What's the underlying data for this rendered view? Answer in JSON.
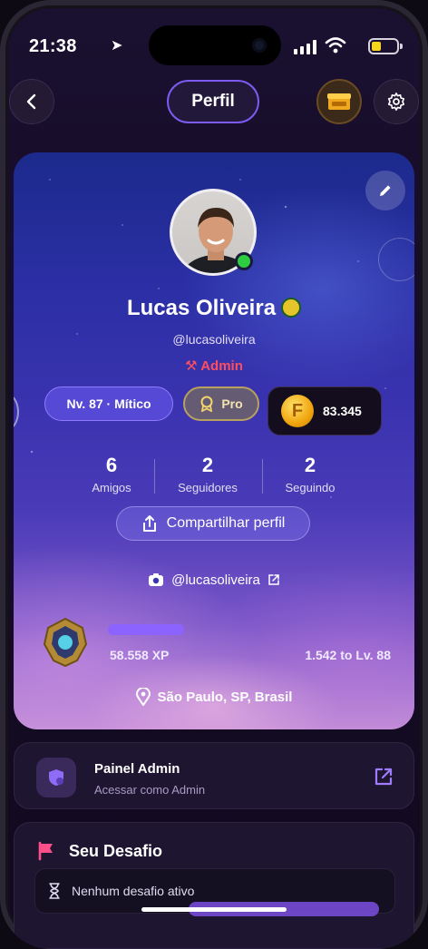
{
  "status_bar": {
    "time": "21:38"
  },
  "header": {
    "title": "Perfil"
  },
  "profile": {
    "name": "Lucas Oliveira",
    "handle": "@lucasoliveira",
    "role": "Admin",
    "level": "Nv. 87 · Mítico",
    "tier": "Pro",
    "coins": "83.345",
    "coin_letter": "F",
    "stats": [
      {
        "value": "6",
        "label": "Amigos"
      },
      {
        "value": "2",
        "label": "Seguidores"
      },
      {
        "value": "2",
        "label": "Seguindo"
      }
    ],
    "share_label": "Compartilhar perfil",
    "instagram": "@lucasoliveira",
    "xp": "58.558 XP",
    "xp_to_next": "1.542 to Lv. 88",
    "location": "São Paulo, SP, Brasil"
  },
  "admin_panel": {
    "title": "Painel Admin",
    "subtitle": "Acessar como Admin"
  },
  "challenge": {
    "title": "Seu Desafio",
    "empty": "Nenhum desafio ativo"
  },
  "colors": {
    "accent": "#7c5cf0",
    "admin": "#ff4f5e",
    "online": "#2ecc40",
    "coin": "#f0a50e"
  }
}
